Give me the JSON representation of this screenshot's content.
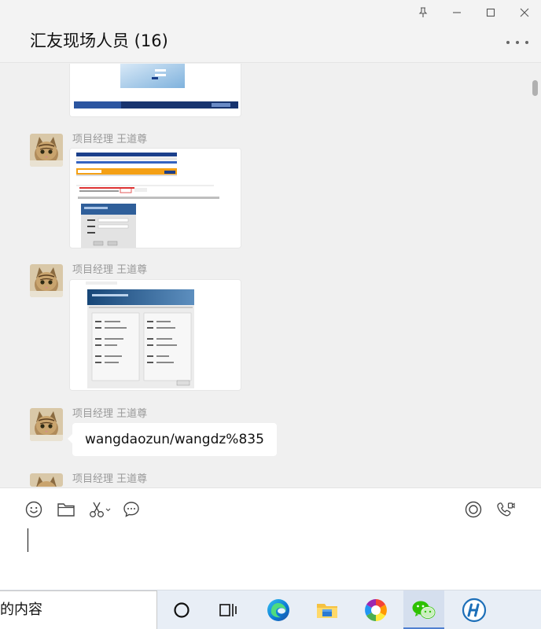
{
  "window": {
    "controls": [
      "pin",
      "minimize",
      "maximize",
      "close"
    ]
  },
  "header": {
    "title": "汇友现场人员 (16)"
  },
  "messages": [
    {
      "type": "image",
      "sender": "",
      "content": "screenshot-login-window"
    },
    {
      "type": "image",
      "sender": "项目经理 王道尊",
      "content": "screenshot-browser-dialog"
    },
    {
      "type": "image",
      "sender": "项目经理 王道尊",
      "content": "screenshot-config-panel"
    },
    {
      "type": "text",
      "sender": "项目经理 王道尊",
      "text": "wangdaozun/wangdz%835"
    },
    {
      "type": "partial",
      "sender": "项目经理 王道尊"
    }
  ],
  "toolbar": {
    "left_icons": [
      "emoji-icon",
      "folder-icon",
      "scissors-icon",
      "chat-bubble-icon"
    ],
    "right_icons": [
      "live-icon",
      "call-icon"
    ]
  },
  "taskbar": {
    "search_text": "的内容",
    "apps": [
      "cortana",
      "task-view",
      "edge",
      "file-explorer",
      "colorful-app",
      "wechat",
      "hunter-app"
    ]
  },
  "colors": {
    "wechat_green": "#2dc100",
    "background": "#f0f0f0"
  }
}
